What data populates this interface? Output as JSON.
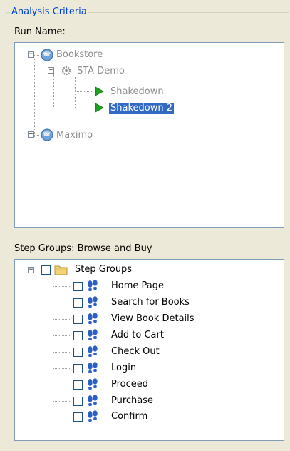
{
  "group": {
    "legend": "Analysis Criteria"
  },
  "run_name": {
    "label": "Run Name:",
    "tree": {
      "bookstore": {
        "label": "Bookstore",
        "icon": "globe-icon"
      },
      "sta_demo": {
        "label": "STA Demo",
        "icon": "gear-icon"
      },
      "shakedown": {
        "label": "Shakedown",
        "icon": "play-icon"
      },
      "shakedown2": {
        "label": "Shakedown 2",
        "icon": "play-icon",
        "selected": true
      },
      "maximo": {
        "label": "Maximo",
        "icon": "globe-icon"
      }
    }
  },
  "step_groups": {
    "label": "Step Groups: Browse and Buy",
    "root": {
      "label": "Step Groups",
      "icon": "folder-icon"
    },
    "items": [
      {
        "label": "Home Page"
      },
      {
        "label": "Search for Books"
      },
      {
        "label": "View Book Details"
      },
      {
        "label": "Add to Cart"
      },
      {
        "label": "Check Out"
      },
      {
        "label": "Login"
      },
      {
        "label": "Proceed"
      },
      {
        "label": "Purchase"
      },
      {
        "label": "Confirm"
      }
    ]
  },
  "colors": {
    "legend": "#0046d5",
    "selection": "#316ac5",
    "panel_border": "#7f9db9",
    "play_icon": "#1ea11e",
    "footprint_icon": "#2a5fc4"
  }
}
